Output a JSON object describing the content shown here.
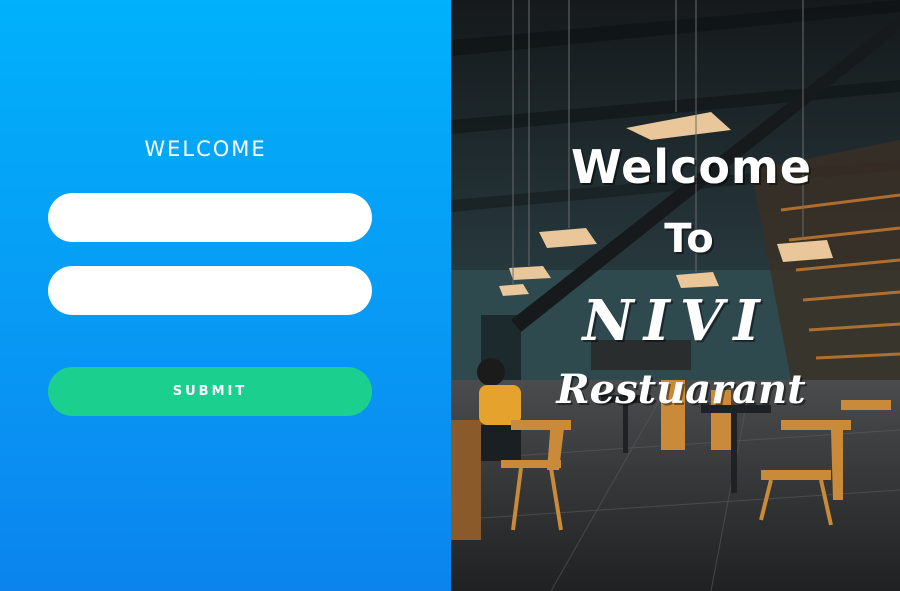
{
  "login": {
    "title": "WELCOME",
    "username_value": "",
    "password_value": "",
    "submit_label": "SUBMIT"
  },
  "banner": {
    "line1": "Welcome",
    "line2": "To",
    "line3": "NIVI",
    "line4": "Restuarant"
  },
  "colors": {
    "panel_top": "#00b1fb",
    "panel_bottom": "#0b84ee",
    "submit_bg": "#1bcf8f",
    "field_bg": "#ffffff"
  }
}
